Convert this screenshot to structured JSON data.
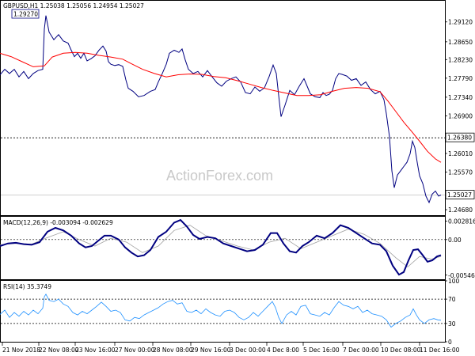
{
  "chart_data": {
    "type": "line",
    "title": "GBPUSD,H1  1.25038 1.25056 1.24954 1.25027",
    "watermark": "ActionForex.com",
    "x_ticks": [
      "21 Nov 2018",
      "22 Nov 08:00",
      "23 Nov 16:00",
      "27 Nov 00:00",
      "28 Nov 08:00",
      "29 Nov 16:00",
      "3 Dec 00:00",
      "4 Dec 8:00",
      "5 Dec 16:00",
      "7 Dec 00:00",
      "10 Dec 08:00",
      "11 Dec 16:00"
    ],
    "price_panel": {
      "y_ticks": [
        "1.29120",
        "1.28650",
        "1.28230",
        "1.27790",
        "1.27340",
        "1.26900",
        "1.26010",
        "1.25570",
        "1.24680"
      ],
      "ylim": [
        1.2455,
        1.2962
      ],
      "annotation_high": "1.29270",
      "level_label": "1.26380",
      "level_value": 1.2638,
      "current_label": "1.25027",
      "current_value": 1.25027,
      "ma_color": "#ff0000",
      "price_color": "#000080",
      "ma": [
        [
          0,
          1.2838
        ],
        [
          14,
          1.283
        ],
        [
          28,
          1.2818
        ],
        [
          42,
          1.2806
        ],
        [
          56,
          1.2808
        ],
        [
          66,
          1.2829
        ],
        [
          80,
          1.2838
        ],
        [
          95,
          1.284
        ],
        [
          110,
          1.2838
        ],
        [
          125,
          1.2833
        ],
        [
          140,
          1.2829
        ],
        [
          155,
          1.2824
        ],
        [
          165,
          1.2814
        ],
        [
          180,
          1.28
        ],
        [
          195,
          1.279
        ],
        [
          210,
          1.2782
        ],
        [
          225,
          1.2787
        ],
        [
          240,
          1.2789
        ],
        [
          255,
          1.2788
        ],
        [
          270,
          1.2783
        ],
        [
          285,
          1.278
        ],
        [
          300,
          1.2773
        ],
        [
          315,
          1.2765
        ],
        [
          330,
          1.2757
        ],
        [
          345,
          1.275
        ],
        [
          360,
          1.2744
        ],
        [
          375,
          1.2738
        ],
        [
          390,
          1.2738
        ],
        [
          405,
          1.274
        ],
        [
          420,
          1.2748
        ],
        [
          435,
          1.2755
        ],
        [
          450,
          1.2757
        ],
        [
          465,
          1.2755
        ],
        [
          480,
          1.2747
        ],
        [
          490,
          1.2725
        ],
        [
          500,
          1.27
        ],
        [
          510,
          1.2675
        ],
        [
          520,
          1.2653
        ],
        [
          530,
          1.263
        ],
        [
          540,
          1.2606
        ],
        [
          550,
          1.2588
        ],
        [
          557,
          1.258
        ]
      ],
      "price": [
        [
          0,
          1.2787
        ],
        [
          6,
          1.28
        ],
        [
          12,
          1.279
        ],
        [
          18,
          1.28
        ],
        [
          24,
          1.2782
        ],
        [
          30,
          1.2795
        ],
        [
          36,
          1.2778
        ],
        [
          42,
          1.279
        ],
        [
          48,
          1.2797
        ],
        [
          54,
          1.28
        ],
        [
          56,
          1.2895
        ],
        [
          58,
          1.2927
        ],
        [
          62,
          1.2888
        ],
        [
          68,
          1.287
        ],
        [
          74,
          1.2882
        ],
        [
          80,
          1.2867
        ],
        [
          86,
          1.2862
        ],
        [
          90,
          1.2845
        ],
        [
          94,
          1.283
        ],
        [
          98,
          1.2838
        ],
        [
          102,
          1.2826
        ],
        [
          106,
          1.2838
        ],
        [
          110,
          1.282
        ],
        [
          115,
          1.2825
        ],
        [
          120,
          1.2832
        ],
        [
          125,
          1.2845
        ],
        [
          130,
          1.2855
        ],
        [
          134,
          1.2843
        ],
        [
          137,
          1.2818
        ],
        [
          140,
          1.2812
        ],
        [
          145,
          1.2809
        ],
        [
          150,
          1.2811
        ],
        [
          155,
          1.2807
        ],
        [
          159,
          1.2775
        ],
        [
          162,
          1.2755
        ],
        [
          168,
          1.2748
        ],
        [
          175,
          1.2735
        ],
        [
          182,
          1.2738
        ],
        [
          190,
          1.2748
        ],
        [
          196,
          1.2752
        ],
        [
          200,
          1.277
        ],
        [
          205,
          1.279
        ],
        [
          210,
          1.2812
        ],
        [
          214,
          1.2838
        ],
        [
          220,
          1.2845
        ],
        [
          226,
          1.284
        ],
        [
          230,
          1.2848
        ],
        [
          234,
          1.2822
        ],
        [
          238,
          1.28
        ],
        [
          244,
          1.279
        ],
        [
          250,
          1.2795
        ],
        [
          256,
          1.2782
        ],
        [
          262,
          1.2797
        ],
        [
          268,
          1.2782
        ],
        [
          274,
          1.2768
        ],
        [
          280,
          1.276
        ],
        [
          286,
          1.2772
        ],
        [
          292,
          1.2778
        ],
        [
          298,
          1.2782
        ],
        [
          304,
          1.277
        ],
        [
          310,
          1.2745
        ],
        [
          316,
          1.2742
        ],
        [
          322,
          1.2758
        ],
        [
          328,
          1.2748
        ],
        [
          334,
          1.2756
        ],
        [
          340,
          1.2783
        ],
        [
          345,
          1.281
        ],
        [
          349,
          1.279
        ],
        [
          352,
          1.2738
        ],
        [
          355,
          1.2688
        ],
        [
          360,
          1.2715
        ],
        [
          366,
          1.275
        ],
        [
          372,
          1.274
        ],
        [
          378,
          1.276
        ],
        [
          384,
          1.2778
        ],
        [
          388,
          1.276
        ],
        [
          392,
          1.2742
        ],
        [
          398,
          1.2735
        ],
        [
          404,
          1.2733
        ],
        [
          408,
          1.2745
        ],
        [
          412,
          1.2738
        ],
        [
          416,
          1.2741
        ],
        [
          420,
          1.275
        ],
        [
          424,
          1.2778
        ],
        [
          428,
          1.279
        ],
        [
          432,
          1.2788
        ],
        [
          438,
          1.2784
        ],
        [
          444,
          1.2774
        ],
        [
          450,
          1.2778
        ],
        [
          456,
          1.2762
        ],
        [
          462,
          1.277
        ],
        [
          468,
          1.2752
        ],
        [
          474,
          1.2742
        ],
        [
          480,
          1.2748
        ],
        [
          485,
          1.2728
        ],
        [
          488,
          1.2695
        ],
        [
          492,
          1.264
        ],
        [
          495,
          1.256
        ],
        [
          498,
          1.252
        ],
        [
          502,
          1.255
        ],
        [
          506,
          1.256
        ],
        [
          510,
          1.257
        ],
        [
          514,
          1.258
        ],
        [
          518,
          1.26
        ],
        [
          521,
          1.263
        ],
        [
          524,
          1.2615
        ],
        [
          527,
          1.258
        ],
        [
          530,
          1.2548
        ],
        [
          534,
          1.253
        ],
        [
          538,
          1.25
        ],
        [
          542,
          1.2485
        ],
        [
          546,
          1.2505
        ],
        [
          550,
          1.2512
        ],
        [
          554,
          1.25
        ],
        [
          557,
          1.25027
        ]
      ]
    },
    "macd_panel": {
      "label": "MACD(12,26,9) -0.003094 -0.002629",
      "y_ticks": [
        "0.002816",
        "0.00",
        "-0.005464"
      ],
      "ylim": [
        -0.0061,
        0.0035
      ],
      "zero_value": 0.0,
      "main_color": "#000080",
      "signal_color": "#a0a0a0",
      "main": [
        [
          0,
          -0.001
        ],
        [
          10,
          -0.0006
        ],
        [
          20,
          -0.0005
        ],
        [
          30,
          -0.0007
        ],
        [
          40,
          -0.0008
        ],
        [
          50,
          -0.0004
        ],
        [
          60,
          0.0012
        ],
        [
          70,
          0.0018
        ],
        [
          80,
          0.0014
        ],
        [
          90,
          0.0006
        ],
        [
          100,
          -0.0006
        ],
        [
          108,
          -0.0012
        ],
        [
          116,
          -0.001
        ],
        [
          124,
          -0.0002
        ],
        [
          132,
          0.0006
        ],
        [
          140,
          0.0006
        ],
        [
          150,
          0.0
        ],
        [
          158,
          -0.0012
        ],
        [
          166,
          -0.002
        ],
        [
          174,
          -0.0026
        ],
        [
          182,
          -0.0024
        ],
        [
          190,
          -0.0016
        ],
        [
          200,
          0.0004
        ],
        [
          210,
          0.0012
        ],
        [
          220,
          0.0026
        ],
        [
          228,
          0.003
        ],
        [
          236,
          0.002
        ],
        [
          244,
          0.0007
        ],
        [
          252,
          0.0001
        ],
        [
          262,
          0.0004
        ],
        [
          272,
          0.0002
        ],
        [
          282,
          -0.0006
        ],
        [
          292,
          -0.001
        ],
        [
          302,
          -0.0014
        ],
        [
          312,
          -0.0018
        ],
        [
          322,
          -0.0016
        ],
        [
          332,
          -0.0008
        ],
        [
          342,
          0.001
        ],
        [
          350,
          0.001
        ],
        [
          358,
          -0.0006
        ],
        [
          366,
          -0.0018
        ],
        [
          374,
          -0.002
        ],
        [
          382,
          -0.001
        ],
        [
          390,
          -0.0004
        ],
        [
          400,
          0.0006
        ],
        [
          410,
          0.0002
        ],
        [
          420,
          0.001
        ],
        [
          430,
          0.0022
        ],
        [
          440,
          0.0018
        ],
        [
          450,
          0.001
        ],
        [
          460,
          0.0002
        ],
        [
          470,
          -0.0006
        ],
        [
          480,
          -0.0008
        ],
        [
          488,
          -0.0018
        ],
        [
          496,
          -0.004
        ],
        [
          504,
          -0.0054
        ],
        [
          510,
          -0.005
        ],
        [
          516,
          -0.0032
        ],
        [
          522,
          -0.0016
        ],
        [
          528,
          -0.0015
        ],
        [
          534,
          -0.0024
        ],
        [
          540,
          -0.0034
        ],
        [
          546,
          -0.0032
        ],
        [
          552,
          -0.0026
        ],
        [
          557,
          -0.0024
        ]
      ],
      "signal": [
        [
          0,
          -0.0008
        ],
        [
          20,
          -0.0006
        ],
        [
          40,
          -0.0007
        ],
        [
          60,
          0.0003
        ],
        [
          80,
          0.0012
        ],
        [
          100,
          0.0
        ],
        [
          120,
          -0.001
        ],
        [
          140,
          0.0002
        ],
        [
          160,
          -0.0004
        ],
        [
          180,
          -0.002
        ],
        [
          200,
          -0.001
        ],
        [
          220,
          0.0014
        ],
        [
          240,
          0.0022
        ],
        [
          260,
          0.0006
        ],
        [
          280,
          -0.0002
        ],
        [
          300,
          -0.001
        ],
        [
          320,
          -0.0016
        ],
        [
          340,
          -0.0004
        ],
        [
          360,
          0.0002
        ],
        [
          380,
          -0.0014
        ],
        [
          400,
          -0.0004
        ],
        [
          420,
          0.0006
        ],
        [
          440,
          0.0016
        ],
        [
          460,
          0.0008
        ],
        [
          480,
          -0.0006
        ],
        [
          500,
          -0.0028
        ],
        [
          515,
          -0.0042
        ],
        [
          530,
          -0.0026
        ],
        [
          545,
          -0.003
        ],
        [
          557,
          -0.0026
        ]
      ]
    },
    "rsi_panel": {
      "label": "RSI(14) 35.3749",
      "y_ticks": [
        "100",
        "70",
        "30",
        "0"
      ],
      "ylim": [
        0,
        100
      ],
      "levels": [
        70,
        30
      ],
      "line_color": "#1e90ff",
      "values": [
        [
          0,
          45
        ],
        [
          6,
          52
        ],
        [
          12,
          40
        ],
        [
          18,
          48
        ],
        [
          24,
          42
        ],
        [
          30,
          50
        ],
        [
          36,
          44
        ],
        [
          42,
          52
        ],
        [
          48,
          46
        ],
        [
          54,
          55
        ],
        [
          56,
          74
        ],
        [
          58,
          78
        ],
        [
          62,
          68
        ],
        [
          68,
          66
        ],
        [
          74,
          70
        ],
        [
          80,
          62
        ],
        [
          86,
          58
        ],
        [
          92,
          48
        ],
        [
          98,
          44
        ],
        [
          104,
          50
        ],
        [
          110,
          46
        ],
        [
          116,
          52
        ],
        [
          122,
          58
        ],
        [
          128,
          65
        ],
        [
          134,
          58
        ],
        [
          140,
          50
        ],
        [
          146,
          52
        ],
        [
          152,
          48
        ],
        [
          158,
          36
        ],
        [
          164,
          34
        ],
        [
          170,
          40
        ],
        [
          176,
          38
        ],
        [
          182,
          44
        ],
        [
          188,
          48
        ],
        [
          194,
          52
        ],
        [
          200,
          56
        ],
        [
          206,
          62
        ],
        [
          212,
          66
        ],
        [
          218,
          68
        ],
        [
          224,
          62
        ],
        [
          230,
          64
        ],
        [
          236,
          50
        ],
        [
          242,
          48
        ],
        [
          248,
          52
        ],
        [
          254,
          46
        ],
        [
          260,
          54
        ],
        [
          266,
          48
        ],
        [
          272,
          44
        ],
        [
          278,
          42
        ],
        [
          284,
          50
        ],
        [
          290,
          52
        ],
        [
          296,
          48
        ],
        [
          302,
          40
        ],
        [
          308,
          36
        ],
        [
          314,
          40
        ],
        [
          320,
          48
        ],
        [
          326,
          42
        ],
        [
          332,
          50
        ],
        [
          338,
          58
        ],
        [
          344,
          66
        ],
        [
          348,
          56
        ],
        [
          352,
          40
        ],
        [
          356,
          30
        ],
        [
          362,
          44
        ],
        [
          368,
          50
        ],
        [
          374,
          44
        ],
        [
          380,
          58
        ],
        [
          386,
          60
        ],
        [
          392,
          46
        ],
        [
          398,
          44
        ],
        [
          404,
          42
        ],
        [
          410,
          48
        ],
        [
          416,
          44
        ],
        [
          422,
          56
        ],
        [
          428,
          66
        ],
        [
          434,
          60
        ],
        [
          440,
          58
        ],
        [
          446,
          54
        ],
        [
          452,
          58
        ],
        [
          458,
          48
        ],
        [
          464,
          52
        ],
        [
          470,
          46
        ],
        [
          476,
          44
        ],
        [
          482,
          42
        ],
        [
          488,
          36
        ],
        [
          494,
          24
        ],
        [
          500,
          30
        ],
        [
          506,
          34
        ],
        [
          512,
          40
        ],
        [
          518,
          44
        ],
        [
          522,
          54
        ],
        [
          526,
          44
        ],
        [
          530,
          36
        ],
        [
          536,
          30
        ],
        [
          542,
          36
        ],
        [
          548,
          38
        ],
        [
          553,
          36
        ],
        [
          557,
          35.37
        ]
      ]
    }
  }
}
